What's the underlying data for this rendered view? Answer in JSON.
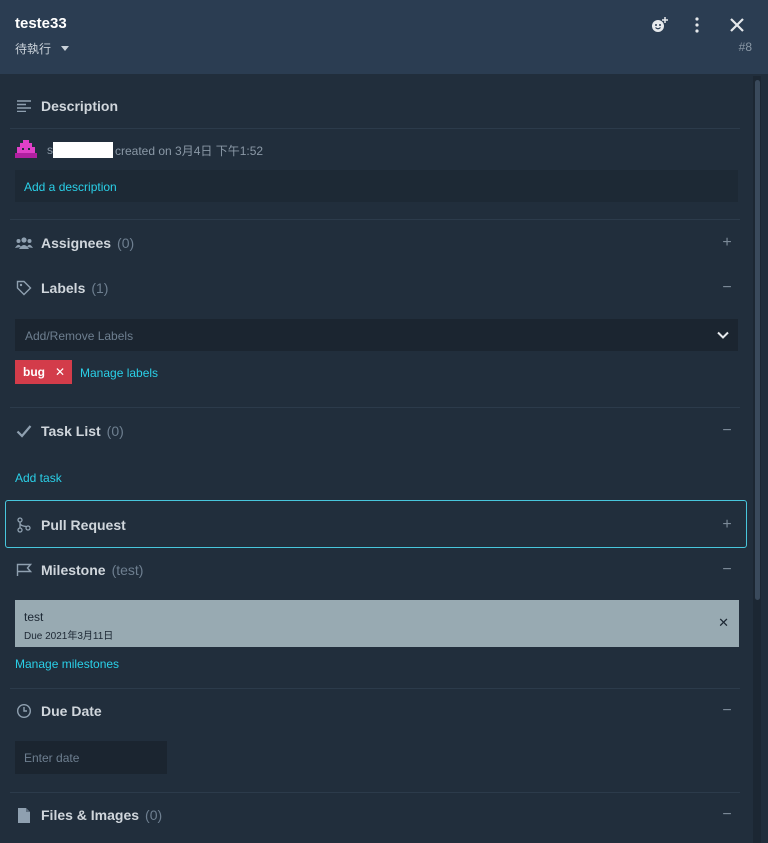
{
  "header": {
    "title": "teste33",
    "status": "待執行",
    "issue_number": "#8"
  },
  "description": {
    "title": "Description",
    "creator_initial": "s",
    "created_text": "created on 3月4日 下午1:52",
    "add_link": "Add a description"
  },
  "assignees": {
    "title": "Assignees",
    "count": "(0)",
    "action": "+"
  },
  "labels": {
    "title": "Labels",
    "count": "(1)",
    "action": "−",
    "placeholder": "Add/Remove Labels",
    "tags": [
      {
        "name": "bug",
        "color": "#d33c4a"
      }
    ],
    "manage_link": "Manage labels"
  },
  "task_list": {
    "title": "Task List",
    "count": "(0)",
    "action": "−",
    "add_link": "Add task"
  },
  "pull_request": {
    "title": "Pull Request",
    "action": "+"
  },
  "milestone": {
    "title": "Milestone",
    "count": "(test)",
    "action": "−",
    "name": "test",
    "due": "Due 2021年3月11日",
    "manage_link": "Manage milestones"
  },
  "due_date": {
    "title": "Due Date",
    "action": "−",
    "placeholder": "Enter date"
  },
  "files": {
    "title": "Files & Images",
    "count": "(0)",
    "action": "−"
  },
  "icons": {
    "header": [
      "emoji-add-icon",
      "more-vertical-icon",
      "close-icon"
    ],
    "sections": [
      "align-left-icon",
      "users-icon",
      "tag-icon",
      "check-icon",
      "git-branch-icon",
      "flag-icon",
      "clock-icon",
      "file-icon"
    ]
  },
  "colors": {
    "accent": "#2ad0e8",
    "header_bg": "#2b3d52",
    "panel_bg": "#212e3c",
    "bug_label": "#d33c4a",
    "milestone_card": "#98aab2"
  }
}
